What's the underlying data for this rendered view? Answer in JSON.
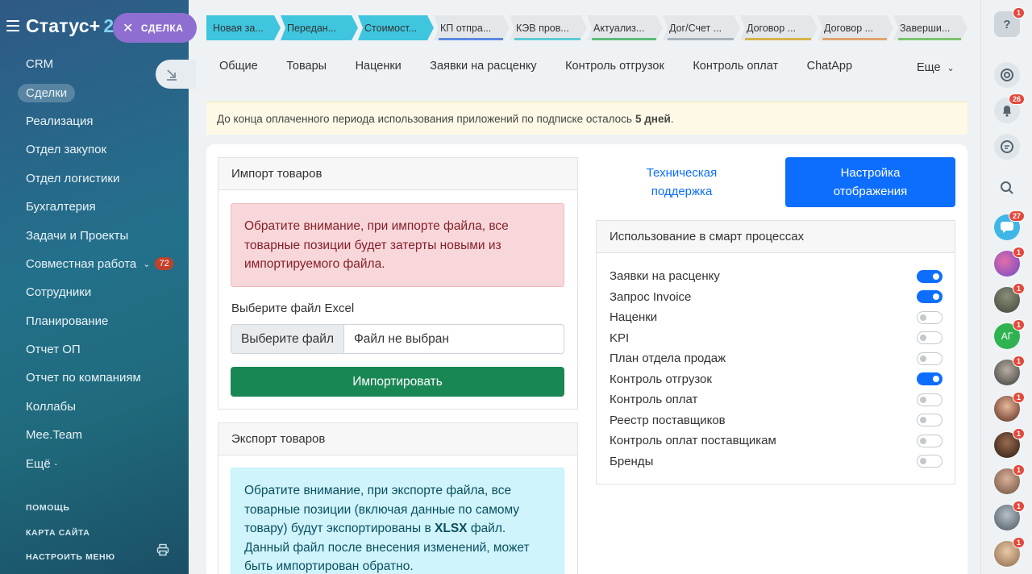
{
  "sidebar": {
    "logo": "Статус+",
    "logo_extra": "2",
    "deal_chip": "СДЕЛКА",
    "items": [
      {
        "label": "CRM"
      },
      {
        "label": "Сделки",
        "active": true
      },
      {
        "label": "Реализация"
      },
      {
        "label": "Отдел закупок"
      },
      {
        "label": "Отдел логистики"
      },
      {
        "label": "Бухгалтерия"
      },
      {
        "label": "Задачи и Проекты"
      },
      {
        "label": "Совместная работа",
        "badge": "72"
      },
      {
        "label": "Сотрудники"
      },
      {
        "label": "Планирование"
      },
      {
        "label": "Отчет ОП"
      },
      {
        "label": "Отчет по компаниям"
      },
      {
        "label": "Коллабы"
      },
      {
        "label": "Mee.Team"
      },
      {
        "label": "Ещё ·"
      }
    ],
    "footer": {
      "help": "ПОМОЩЬ",
      "sitemap": "КАРТА САЙТА",
      "settings": "НАСТРОИТЬ МЕНЮ"
    }
  },
  "stages": [
    {
      "label": "Новая за...",
      "color": "#3fc6de",
      "line": "#3fc6de"
    },
    {
      "label": "Передан...",
      "color": "#3fc6de",
      "line": "#3fc6de"
    },
    {
      "label": "Стоимост...",
      "color": "#3fc6de",
      "line": "#3fc6de"
    },
    {
      "label": "КП отпра...",
      "color": "#e4e7ea",
      "line": "#5d88e0"
    },
    {
      "label": "КЭВ пров...",
      "color": "#e4e7ea",
      "line": "#5ccbd6"
    },
    {
      "label": "Актуализ...",
      "color": "#e4e7ea",
      "line": "#5cbb7a"
    },
    {
      "label": "Дог/Счет ...",
      "color": "#e4e7ea",
      "line": "#a7b2bb"
    },
    {
      "label": "Договор ...",
      "color": "#e4e7ea",
      "line": "#d6b44a"
    },
    {
      "label": "Договор ...",
      "color": "#e4e7ea",
      "line": "#e0a46b"
    },
    {
      "label": "Заверши...",
      "color": "#e4e7ea",
      "line": "#7cc36b"
    }
  ],
  "tabs": [
    "Общие",
    "Товары",
    "Наценки",
    "Заявки на расценку",
    "Контроль отгрузок",
    "Контроль оплат",
    "ChatApp"
  ],
  "tab_more": "Еще",
  "notice": {
    "text": "До конца оплаченного периода использования приложений по подписке осталось",
    "bold": "5 дней",
    "end": "."
  },
  "import": {
    "title": "Импорт товаров",
    "alert": "Обратите внимание, при импорте файла, все товарные позиции будет затерты новыми из импортируемого файла.",
    "file_label": "Выберите файл Excel",
    "choose": "Выберите файл",
    "no_file": "Файл не выбран",
    "button": "Импортировать"
  },
  "export": {
    "title": "Экспорт товаров",
    "alert_a": "Обратите внимание, при экспорте файла, все товарные позиции (включая данные по самому товару) будут экспортированы в",
    "alert_bold": "XLSX",
    "alert_b": "файл. Данный файл после внесения изменений, может быть импортирован обратно."
  },
  "support": {
    "line1": "Техническая",
    "line2": "поддержка"
  },
  "display": {
    "line1": "Настройка",
    "line2": "отображения"
  },
  "smart": {
    "title": "Использование в смарт процессах",
    "items": [
      {
        "label": "Заявки на расценку",
        "on": true
      },
      {
        "label": "Запрос Invoice",
        "on": true
      },
      {
        "label": "Наценки",
        "on": false
      },
      {
        "label": "KPI",
        "on": false
      },
      {
        "label": "План отдела продаж",
        "on": false
      },
      {
        "label": "Контроль отгрузок",
        "on": true
      },
      {
        "label": "Контроль оплат",
        "on": false
      },
      {
        "label": "Реестр поставщиков",
        "on": false
      },
      {
        "label": "Контроль оплат поставщикам",
        "on": false
      },
      {
        "label": "Бренды",
        "on": false
      }
    ]
  },
  "rightbar": {
    "help_badge": "1",
    "notif_badge": "26",
    "chat_badge": "27",
    "ag_initials": "АГ",
    "avatar_badge": "1"
  }
}
